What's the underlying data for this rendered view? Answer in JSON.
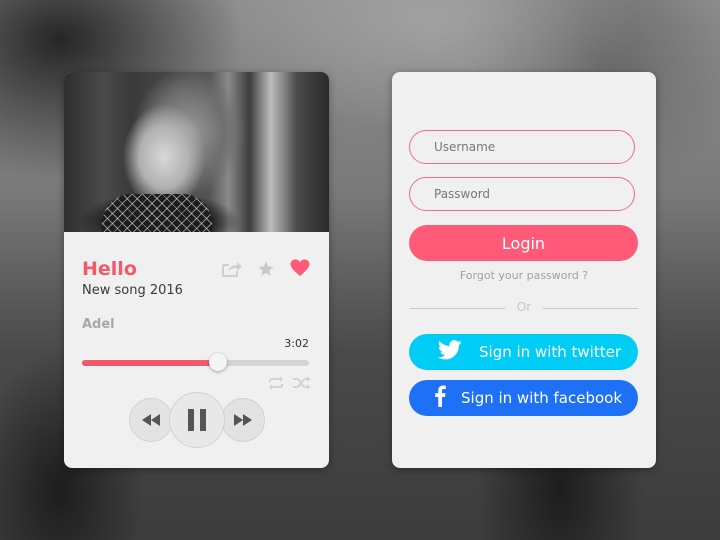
{
  "player": {
    "title": "Hello",
    "subtitle": "New song 2016",
    "artist": "Adel",
    "duration": "3:02",
    "progress_percent": 60,
    "accent_color": "#f05a6a",
    "liked": true,
    "icons": {
      "share": "share-icon",
      "star": "star-icon",
      "heart": "heart-icon",
      "repeat": "repeat-icon",
      "shuffle": "shuffle-icon",
      "rewind": "rewind-icon",
      "pause": "pause-icon",
      "forward": "fast-forward-icon"
    }
  },
  "login": {
    "username_placeholder": "Username",
    "password_placeholder": "Password",
    "login_label": "Login",
    "forgot_label": "Forgot your password ?",
    "or_label": "Or",
    "twitter_label": "Sign in with twitter",
    "facebook_label": "Sign in with facebook",
    "colors": {
      "login": "#ff5b78",
      "twitter": "#00ccf5",
      "facebook": "#1e70f7"
    }
  }
}
